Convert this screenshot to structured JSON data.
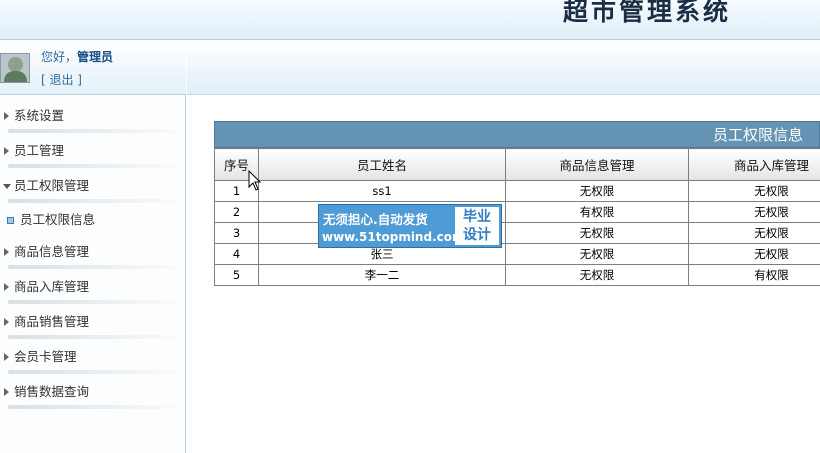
{
  "app": {
    "title": "超市管理系统"
  },
  "user": {
    "greeting": "您好，",
    "name": "管理员",
    "logout_label": "[ 退出 ]"
  },
  "sidebar": {
    "items": [
      {
        "label": "系统设置",
        "expanded": false
      },
      {
        "label": "员工管理",
        "expanded": false
      },
      {
        "label": "员工权限管理",
        "expanded": true
      },
      {
        "label": "员工权限信息",
        "sub": true
      },
      {
        "label": "商品信息管理",
        "expanded": false
      },
      {
        "label": "商品入库管理",
        "expanded": false
      },
      {
        "label": "商品销售管理",
        "expanded": false
      },
      {
        "label": "会员卡管理",
        "expanded": false
      },
      {
        "label": "销售数据查询",
        "expanded": false
      }
    ]
  },
  "panel": {
    "title": "员工权限信息"
  },
  "table": {
    "columns": [
      "序号",
      "员工姓名",
      "商品信息管理",
      "商品入库管理"
    ],
    "rows": [
      [
        "1",
        "ss1",
        "无权限",
        "无权限"
      ],
      [
        "2",
        "",
        "有权限",
        "无权限"
      ],
      [
        "3",
        "",
        "无权限",
        "无权限"
      ],
      [
        "4",
        "张三",
        "无权限",
        "无权限"
      ],
      [
        "5",
        "李一二",
        "无权限",
        "有权限"
      ]
    ]
  },
  "watermark": {
    "line1": "无须担心.自动发货",
    "line2": "www.51topmind.com",
    "badge_line1": "毕业",
    "badge_line2": "设计"
  },
  "colors": {
    "no_permission": "#d40000",
    "has_permission": "#108010",
    "panel_header": "#6593b3"
  }
}
